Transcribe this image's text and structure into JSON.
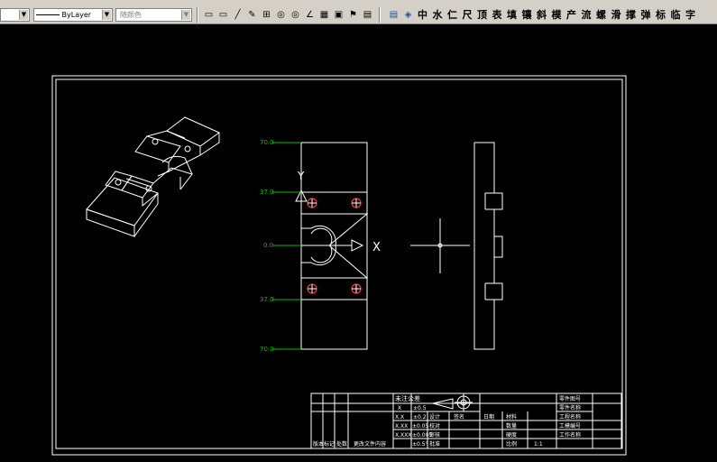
{
  "toolbar": {
    "layer_combo": "",
    "linetype_combo": "ByLayer",
    "color_combo": "随颜色",
    "draw_tools": [
      "rect-tool-icon",
      "rect-tool-icon",
      "line-tool-icon",
      "erase-tool-icon",
      "dim-tool-icon",
      "circle-tool-icon",
      "circle-tool-icon",
      "angle-tool-icon",
      "grid-tool-icon",
      "frame-tool-icon",
      "flag-tool-icon",
      "table-tool-icon"
    ],
    "chinese_buttons": [
      "中",
      "水",
      "仁",
      "尺",
      "顶",
      "表",
      "填",
      "镶",
      "斜",
      "模",
      "产",
      "流",
      "螺",
      "滑",
      "撑",
      "弹",
      "标",
      "临",
      "字"
    ]
  },
  "drawing": {
    "dims_left": [
      "70.0",
      "37.0",
      "0.0",
      "37.0",
      "70.0"
    ],
    "axis_y": "Y",
    "axis_x": "X",
    "colors": {
      "frame": "#ffffff",
      "dimension": "#00c000",
      "hole": "#ff3333"
    }
  },
  "title_block": {
    "tolerance_title": "未注公差",
    "tol_rows": [
      [
        "X",
        "±0.5"
      ],
      [
        "X.X",
        "±0.2"
      ],
      [
        "X.XX",
        "±0.05"
      ],
      [
        "X.XXX",
        "±0.005"
      ],
      [
        "",
        "±0.5°"
      ]
    ],
    "labels": {
      "design": "设计",
      "signature": "签名",
      "date": "日期",
      "check": "校对",
      "review": "审核",
      "approve": "批准",
      "material": "材料",
      "quantity": "数量",
      "hardness": "硬度",
      "scale": "比例",
      "scale_value": "1:1",
      "part_no": "零件图号",
      "part_name": "零件名称",
      "project_name": "工程名称",
      "mold_no": "工模编号",
      "work_name": "工作名称"
    },
    "revision_headers": [
      "版本",
      "标记",
      "处数",
      "更改文件内容"
    ]
  }
}
